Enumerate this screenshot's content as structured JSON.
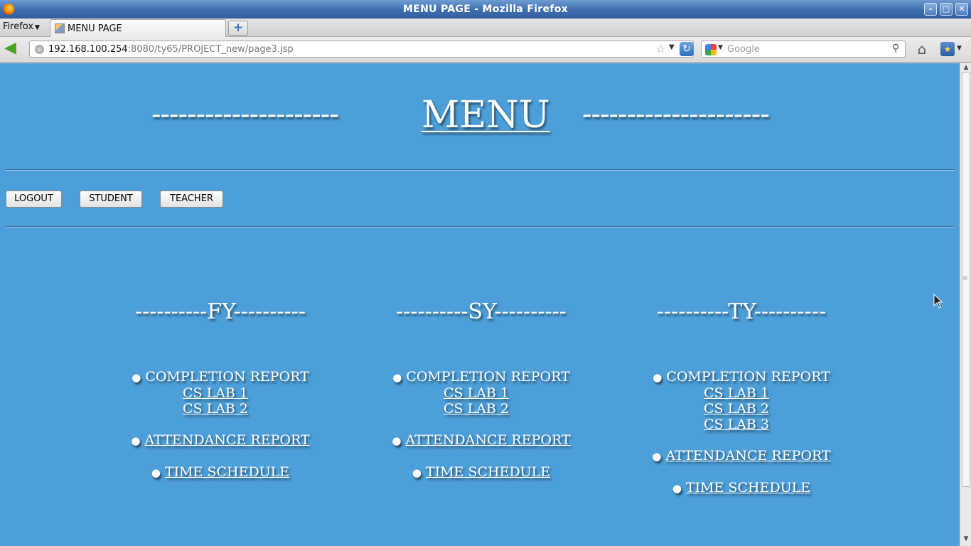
{
  "window": {
    "title": "MENU PAGE - Mozilla Firefox"
  },
  "browser": {
    "menu_label": "Firefox",
    "tab_title": "MENU PAGE",
    "url_host": "192.168.100.254",
    "url_path": ":8080/ty65/PROJECT_new/page3.jsp",
    "search_placeholder": "Google"
  },
  "page": {
    "header": {
      "left_dashes": "---------------------",
      "title": "MENU",
      "right_dashes": "---------------------"
    },
    "buttons": {
      "logout": "LOGOUT",
      "student": "STUDENT",
      "teacher": "TEACHER"
    },
    "columns": [
      {
        "heading": "----------FY----------",
        "completion_label": "COMPLETION REPORT",
        "labs": [
          "CS LAB 1",
          "CS LAB 2"
        ],
        "attendance": "ATTENDANCE REPORT",
        "schedule": "TIME SCHEDULE"
      },
      {
        "heading": "----------SY----------",
        "completion_label": "COMPLETION REPORT",
        "labs": [
          "CS LAB 1",
          "CS LAB 2"
        ],
        "attendance": "ATTENDANCE REPORT",
        "schedule": "TIME SCHEDULE"
      },
      {
        "heading": "----------TY----------",
        "completion_label": "COMPLETION REPORT",
        "labs": [
          "CS LAB 1",
          "CS LAB 2",
          "CS LAB 3"
        ],
        "attendance": "ATTENDANCE REPORT",
        "schedule": "TIME SCHEDULE"
      }
    ]
  },
  "colors": {
    "page_background": "#4d9fd9",
    "text": "#ffffff",
    "titlebar": "#3f6fb0"
  }
}
